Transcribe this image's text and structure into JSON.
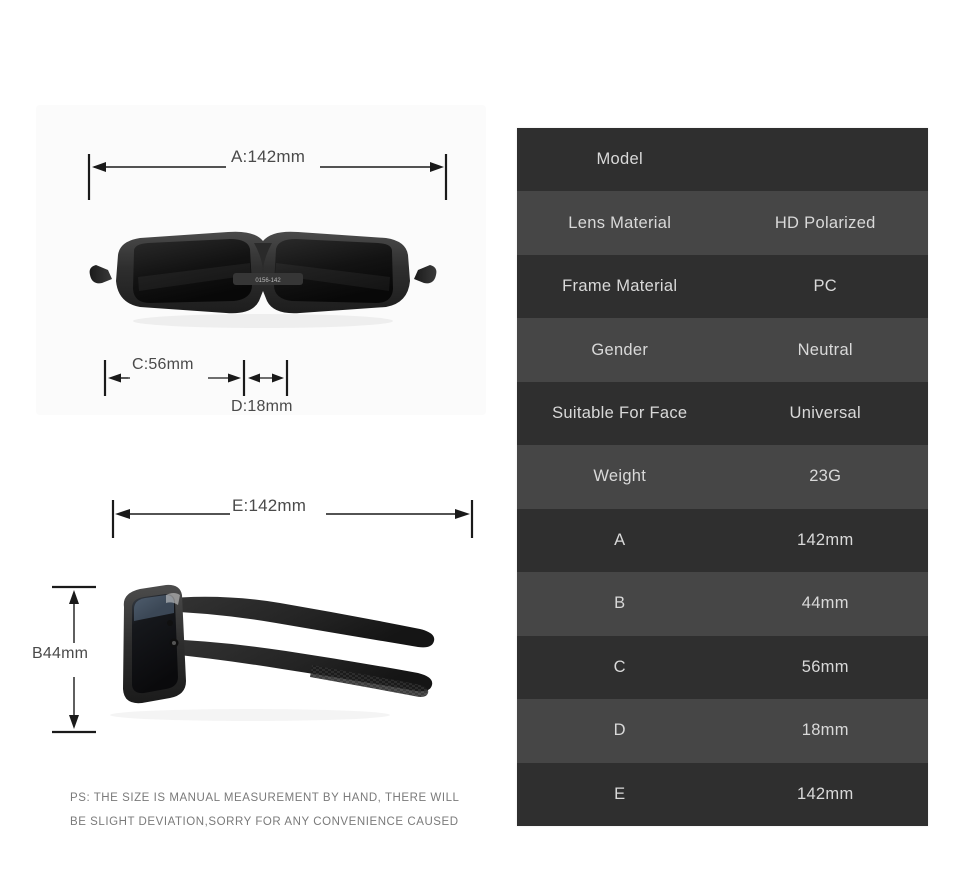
{
  "product": {
    "type": "sunglasses",
    "front_view_alt": "black polarized sunglasses front view",
    "side_view_alt": "black polarized sunglasses side profile view",
    "temple_engraving": "0156-142"
  },
  "dimensions": {
    "a": {
      "code": "A",
      "label": "A:142mm",
      "value": "142mm"
    },
    "b": {
      "code": "B",
      "label": "B44mm",
      "value": "44mm"
    },
    "c": {
      "code": "C",
      "label": "C:56mm",
      "value": "56mm"
    },
    "d": {
      "code": "D",
      "label": "D:18mm",
      "value": "18mm"
    },
    "e": {
      "code": "E",
      "label": "E:142mm",
      "value": "142mm"
    }
  },
  "disclaimer": {
    "line1": "PS: THE SIZE IS MANUAL MEASUREMENT BY HAND, THERE WILL",
    "line2": "BE SLIGHT DEVIATION,SORRY FOR ANY CONVENIENCE CAUSED"
  },
  "spec_table": {
    "rows": [
      {
        "key": "Model",
        "value": "",
        "shade": "dark"
      },
      {
        "key": "Lens Material",
        "value": "HD Polarized",
        "shade": "light"
      },
      {
        "key": "Frame Material",
        "value": "PC",
        "shade": "dark"
      },
      {
        "key": "Gender",
        "value": "Neutral",
        "shade": "light"
      },
      {
        "key": "Suitable For Face",
        "value": "Universal",
        "shade": "dark"
      },
      {
        "key": "Weight",
        "value": "23G",
        "shade": "light"
      },
      {
        "key": "A",
        "value": "142mm",
        "shade": "dark"
      },
      {
        "key": "B",
        "value": "44mm",
        "shade": "light"
      },
      {
        "key": "C",
        "value": "56mm",
        "shade": "dark"
      },
      {
        "key": "D",
        "value": "18mm",
        "shade": "light"
      },
      {
        "key": "E",
        "value": "142mm",
        "shade": "dark"
      }
    ]
  },
  "colors": {
    "page_background": "#ffffff",
    "panel_background": "#fbfbfb",
    "row_dark": "#2f2f2f",
    "row_light": "#464646",
    "table_text": "#d9d9d9",
    "dimension_line": "#1a1a1a",
    "dimension_text": "#4a4a4a",
    "disclaimer_text": "#7a7a7a",
    "frame_black": "#2b2b2b",
    "lens_black": "#111111"
  }
}
